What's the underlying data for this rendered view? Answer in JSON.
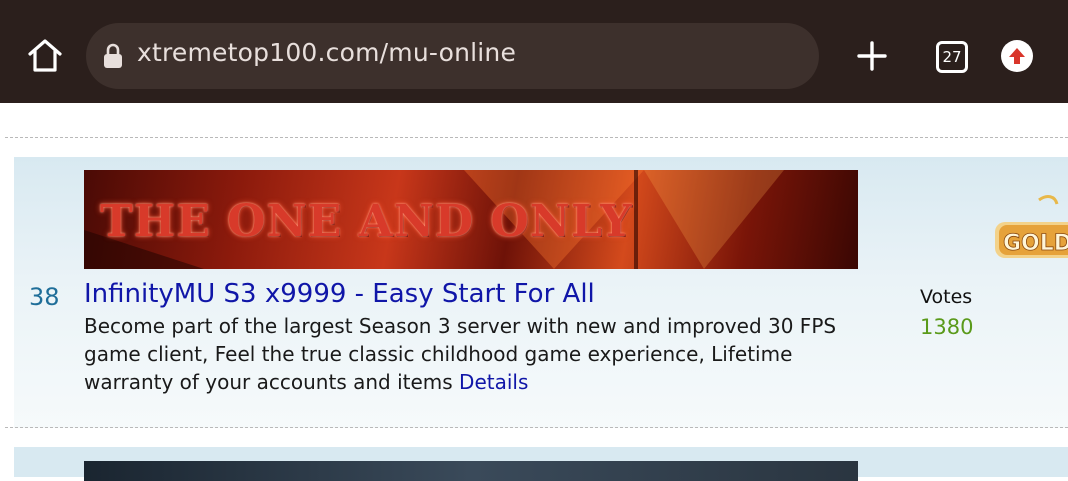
{
  "browser": {
    "url": "xtremetop100.com/mu-online",
    "tab_count": "27",
    "icons": [
      "home-icon",
      "lock-icon",
      "plus-icon",
      "tabs-icon",
      "update-icon"
    ]
  },
  "listing": {
    "rank": "38",
    "banner_text": "THE ONE AND ONLY",
    "title": "InfinityMU S3 x9999 - Easy Start For All",
    "description": "Become part of the largest Season 3 server with new and improved 30 FPS game client, Feel the true classic childhood game experience, Lifetime warranty of your accounts and items ",
    "details_label": "Details",
    "votes_label": "Votes",
    "votes_value": "1380",
    "badge_text": "GOLD"
  },
  "colors": {
    "toolbar": "#2b1f1c",
    "link": "#1016a8",
    "rank": "#1f6e99",
    "votes": "#5a9a1a"
  }
}
